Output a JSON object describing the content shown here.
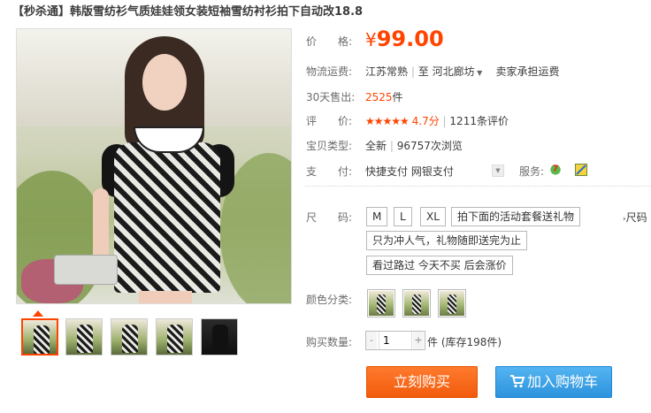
{
  "title": "【秒杀通】韩版雪纺衫气质娃娃领女装短袖雪纺衬衫拍下自动改18.8",
  "price": {
    "label": "价　　格:",
    "currency": "¥",
    "value": "99.00"
  },
  "shipping": {
    "label": "物流运费:",
    "from": "江苏常熟",
    "to_prefix": "至",
    "to": "河北廊坊",
    "note": "卖家承担运费"
  },
  "sales": {
    "label": "30天售出:",
    "count": "2525",
    "unit": "件"
  },
  "rating": {
    "label": "评　　价:",
    "stars": "★★★★★",
    "score": "4.7分",
    "reviews": "1211条评价"
  },
  "item_type": {
    "label": "宝贝类型:",
    "condition": "全新",
    "views": "96757次浏览"
  },
  "payment": {
    "label": "支　　付:",
    "methods": [
      "快捷支付",
      "网银支付"
    ],
    "service_label": "服务:"
  },
  "size": {
    "label": "尺　　码:",
    "options": [
      "M",
      "L",
      "XL",
      "拍下面的活动套餐送礼物",
      "只为冲人气，礼物随即送完为止",
      "看过路过 今天不买 后会涨价"
    ],
    "chart_link": "尺码"
  },
  "color": {
    "label": "颜色分类:",
    "swatches": [
      "swatch-1",
      "swatch-2",
      "swatch-3"
    ]
  },
  "quantity": {
    "label": "购买数量:",
    "value": "1",
    "minus": "-",
    "plus": "+",
    "stock": "件 (库存198件)"
  },
  "buttons": {
    "buy_now": "立刻购买",
    "add_cart": "加入购物车"
  },
  "colors": {
    "accent": "#ff4400",
    "cart_blue": "#2c93dc"
  },
  "icons": {
    "zoom": "magnifier-icon",
    "cart": "cart-icon",
    "service_7": "seven-day-return-icon",
    "service_2": "quality-guarantee-icon"
  }
}
